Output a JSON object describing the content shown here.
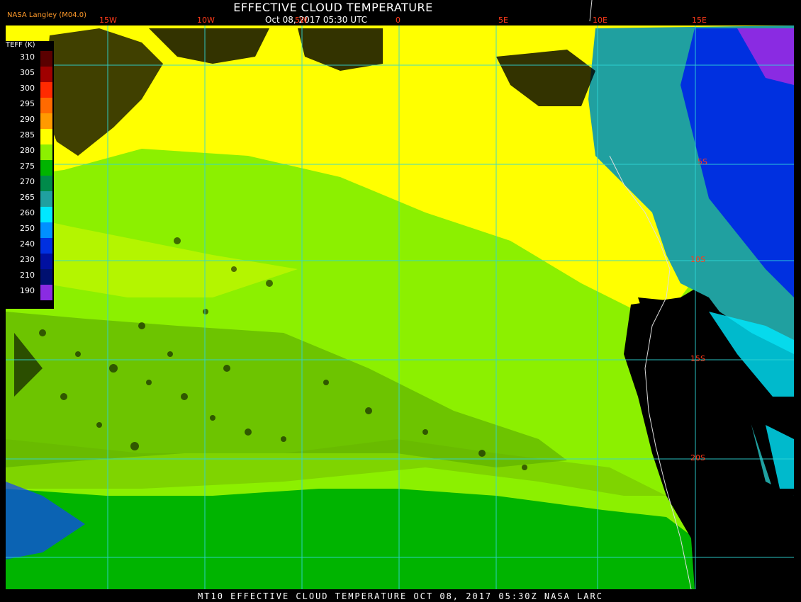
{
  "header": {
    "title": "EFFECTIVE CLOUD TEMPERATURE",
    "subtitle": "Oct 08, 2017 05:30 UTC",
    "source": "NASA Langley (M04.0)"
  },
  "footer": {
    "text": "MT10  EFFECTIVE CLOUD TEMPERATURE  OCT 08, 2017 05:30Z  NASA LARC"
  },
  "grid": {
    "lon_labels": [
      "15W",
      "10W",
      "5W",
      "0",
      "5E",
      "10E",
      "15E"
    ],
    "lat_labels": [
      "5S",
      "10S",
      "15S",
      "20S"
    ],
    "color": "#2fd6d6"
  },
  "legend": {
    "unit": "TEFF (K)",
    "entries": [
      {
        "value": "310",
        "color": "#5a0000"
      },
      {
        "value": "305",
        "color": "#a00000"
      },
      {
        "value": "300",
        "color": "#ff2a00"
      },
      {
        "value": "295",
        "color": "#ff6a00"
      },
      {
        "value": "290",
        "color": "#ff9a00"
      },
      {
        "value": "285",
        "color": "#ffff00"
      },
      {
        "value": "280",
        "color": "#8cf000"
      },
      {
        "value": "275",
        "color": "#00b400"
      },
      {
        "value": "270",
        "color": "#008a4a"
      },
      {
        "value": "265",
        "color": "#20a0a0"
      },
      {
        "value": "260",
        "color": "#00e8ff"
      },
      {
        "value": "250",
        "color": "#0090ff"
      },
      {
        "value": "240",
        "color": "#0030e0"
      },
      {
        "value": "230",
        "color": "#0010a0"
      },
      {
        "value": "210",
        "color": "#001070"
      },
      {
        "value": "190",
        "color": "#8a2be2"
      }
    ]
  },
  "colors": {
    "background": "#000000",
    "land_black": "#000000",
    "low_cloud_green": "#8cf000",
    "mid_yellow": "#ffff00",
    "dark_green": "#00b400"
  }
}
